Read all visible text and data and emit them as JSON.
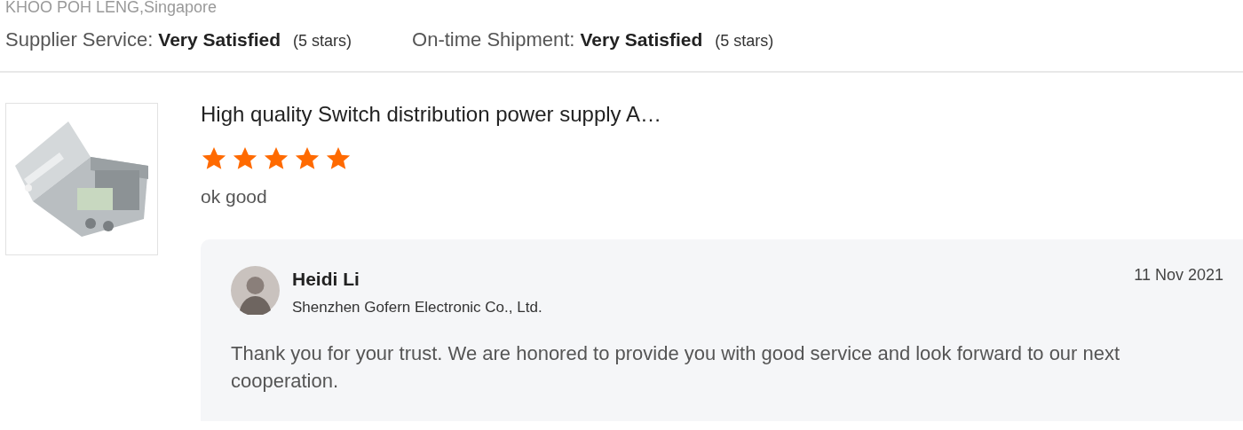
{
  "buyer": "KHOO POH LENG,Singapore",
  "ratings": [
    {
      "label": "Supplier Service:",
      "value": "Very Satisfied",
      "note": "(5 stars)"
    },
    {
      "label": "On-time Shipment:",
      "value": "Very Satisfied",
      "note": "(5 stars)"
    }
  ],
  "review": {
    "product_title": "High quality Switch distribution power supply A…",
    "stars": 5,
    "comment": "ok good",
    "reply": {
      "name": "Heidi Li",
      "company": "Shenzhen Gofern Electronic Co., Ltd.",
      "date": "11 Nov 2021",
      "message": "Thank you for your trust. We are honored to provide you with good service and look forward to our next cooperation."
    }
  }
}
